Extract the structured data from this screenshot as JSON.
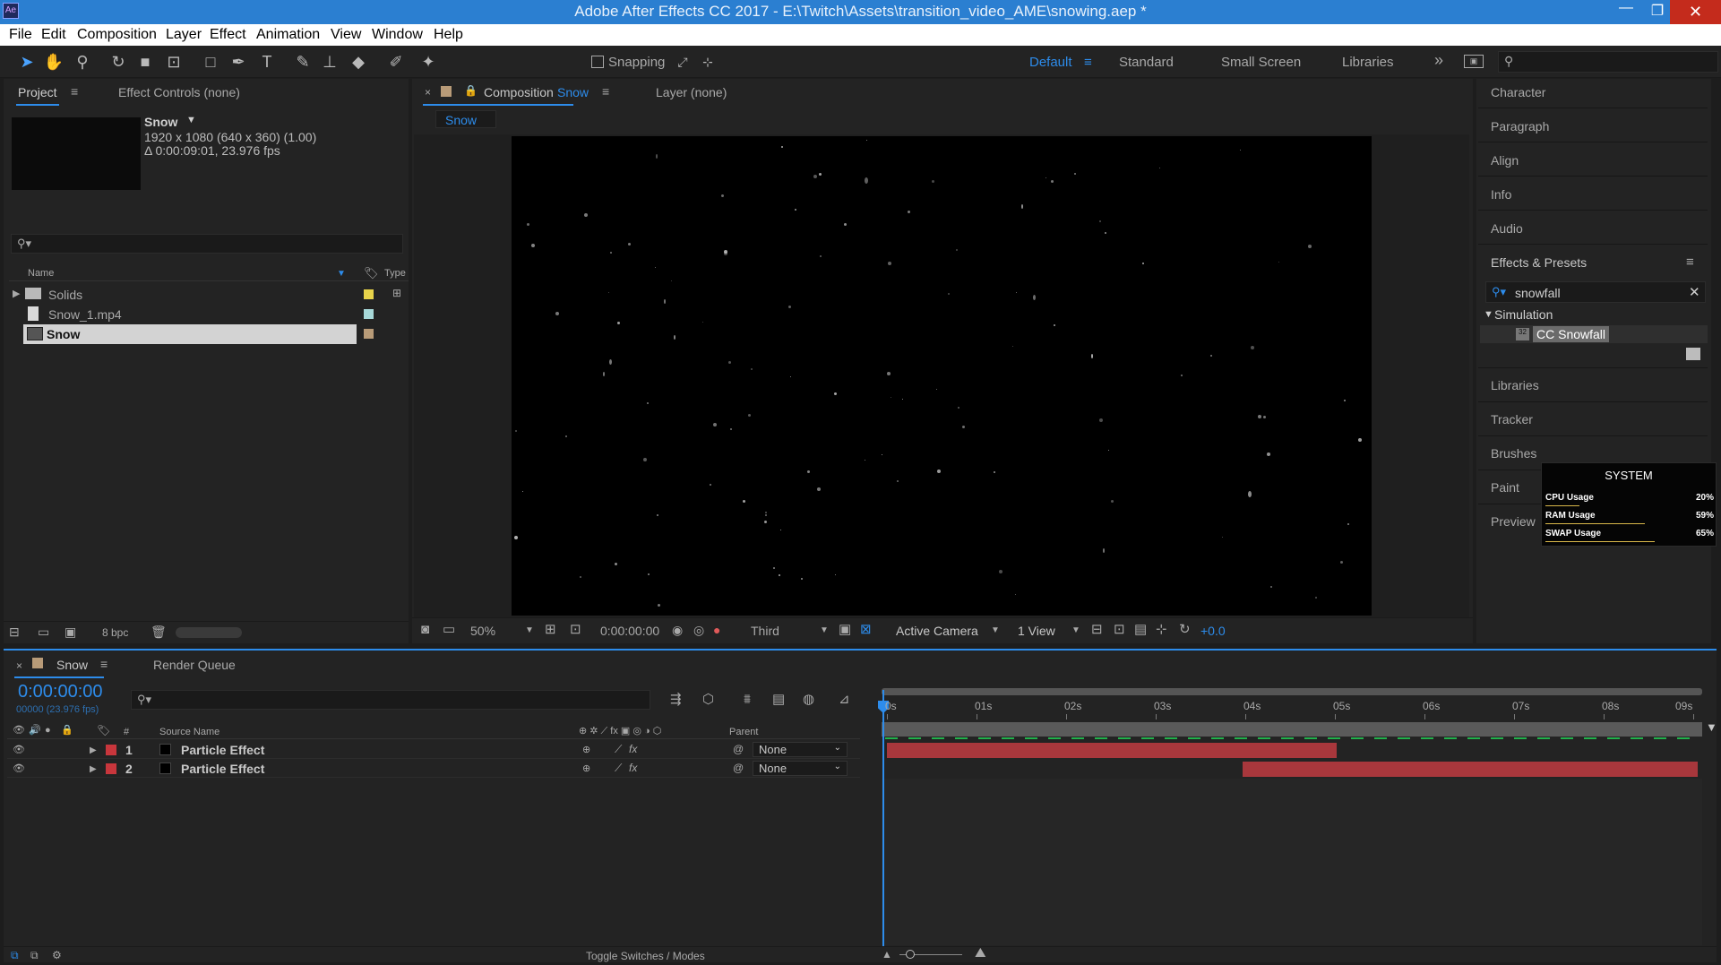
{
  "title": "Adobe After Effects CC 2017 - E:\\Twitch\\Assets\\transition_video_AME\\snowing.aep *",
  "menu": [
    "File",
    "Edit",
    "Composition",
    "Layer",
    "Effect",
    "Animation",
    "View",
    "Window",
    "Help"
  ],
  "toolbar": {
    "snapping": "Snapping",
    "workspaces": {
      "active": "Default",
      "standard": "Standard",
      "small": "Small Screen",
      "libraries": "Libraries"
    }
  },
  "project": {
    "tab": "Project",
    "effect_controls": "Effect Controls (none)",
    "item_name": "Snow",
    "item_res": "1920 x 1080  (640 x 360) (1.00)",
    "item_dur": "Δ 0:00:09:01, 23.976 fps",
    "col_name": "Name",
    "col_type": "Type",
    "rows": [
      "Solids",
      "Snow_1.mp4",
      "Snow"
    ],
    "bpc": "8 bpc"
  },
  "comp": {
    "tab_label": "Composition",
    "tab_name": "Snow",
    "layer_tab": "Layer  (none)",
    "flow": "Snow",
    "zoom": "50%",
    "timecode": "0:00:00:00",
    "resolution": "Third",
    "camera": "Active Camera",
    "view": "1 View",
    "exposure": "+0.0"
  },
  "right": {
    "panels_top": [
      "Character",
      "Paragraph",
      "Align",
      "Info",
      "Audio"
    ],
    "effects_title": "Effects & Presets",
    "search": "snowfall",
    "category": "Simulation",
    "effect": "CC Snowfall",
    "panels_bottom": [
      "Libraries",
      "Tracker",
      "Brushes",
      "Paint",
      "Preview"
    ]
  },
  "system": {
    "title": "SYSTEM",
    "rows": [
      {
        "label": "CPU Usage",
        "value": "20%",
        "pct": 0.2
      },
      {
        "label": "RAM Usage",
        "value": "59%",
        "pct": 0.59
      },
      {
        "label": "SWAP Usage",
        "value": "65%",
        "pct": 0.65
      }
    ]
  },
  "timeline": {
    "tab": "Snow",
    "render_queue": "Render Queue",
    "time": "0:00:00:00",
    "frames": "00000 (23.976 fps)",
    "col_source": "Source Name",
    "col_parent": "Parent",
    "layers": [
      {
        "num": "1",
        "name": "Particle Effect",
        "parent": "None"
      },
      {
        "num": "2",
        "name": "Particle Effect",
        "parent": "None"
      }
    ],
    "ticks": [
      "0s",
      "01s",
      "02s",
      "03s",
      "04s",
      "05s",
      "06s",
      "07s",
      "08s",
      "09s"
    ],
    "toggle": "Toggle Switches / Modes"
  },
  "colors": {
    "accent": "#2d8ceb",
    "label_red": "#c8363c",
    "bar_red": "#a8373c"
  }
}
